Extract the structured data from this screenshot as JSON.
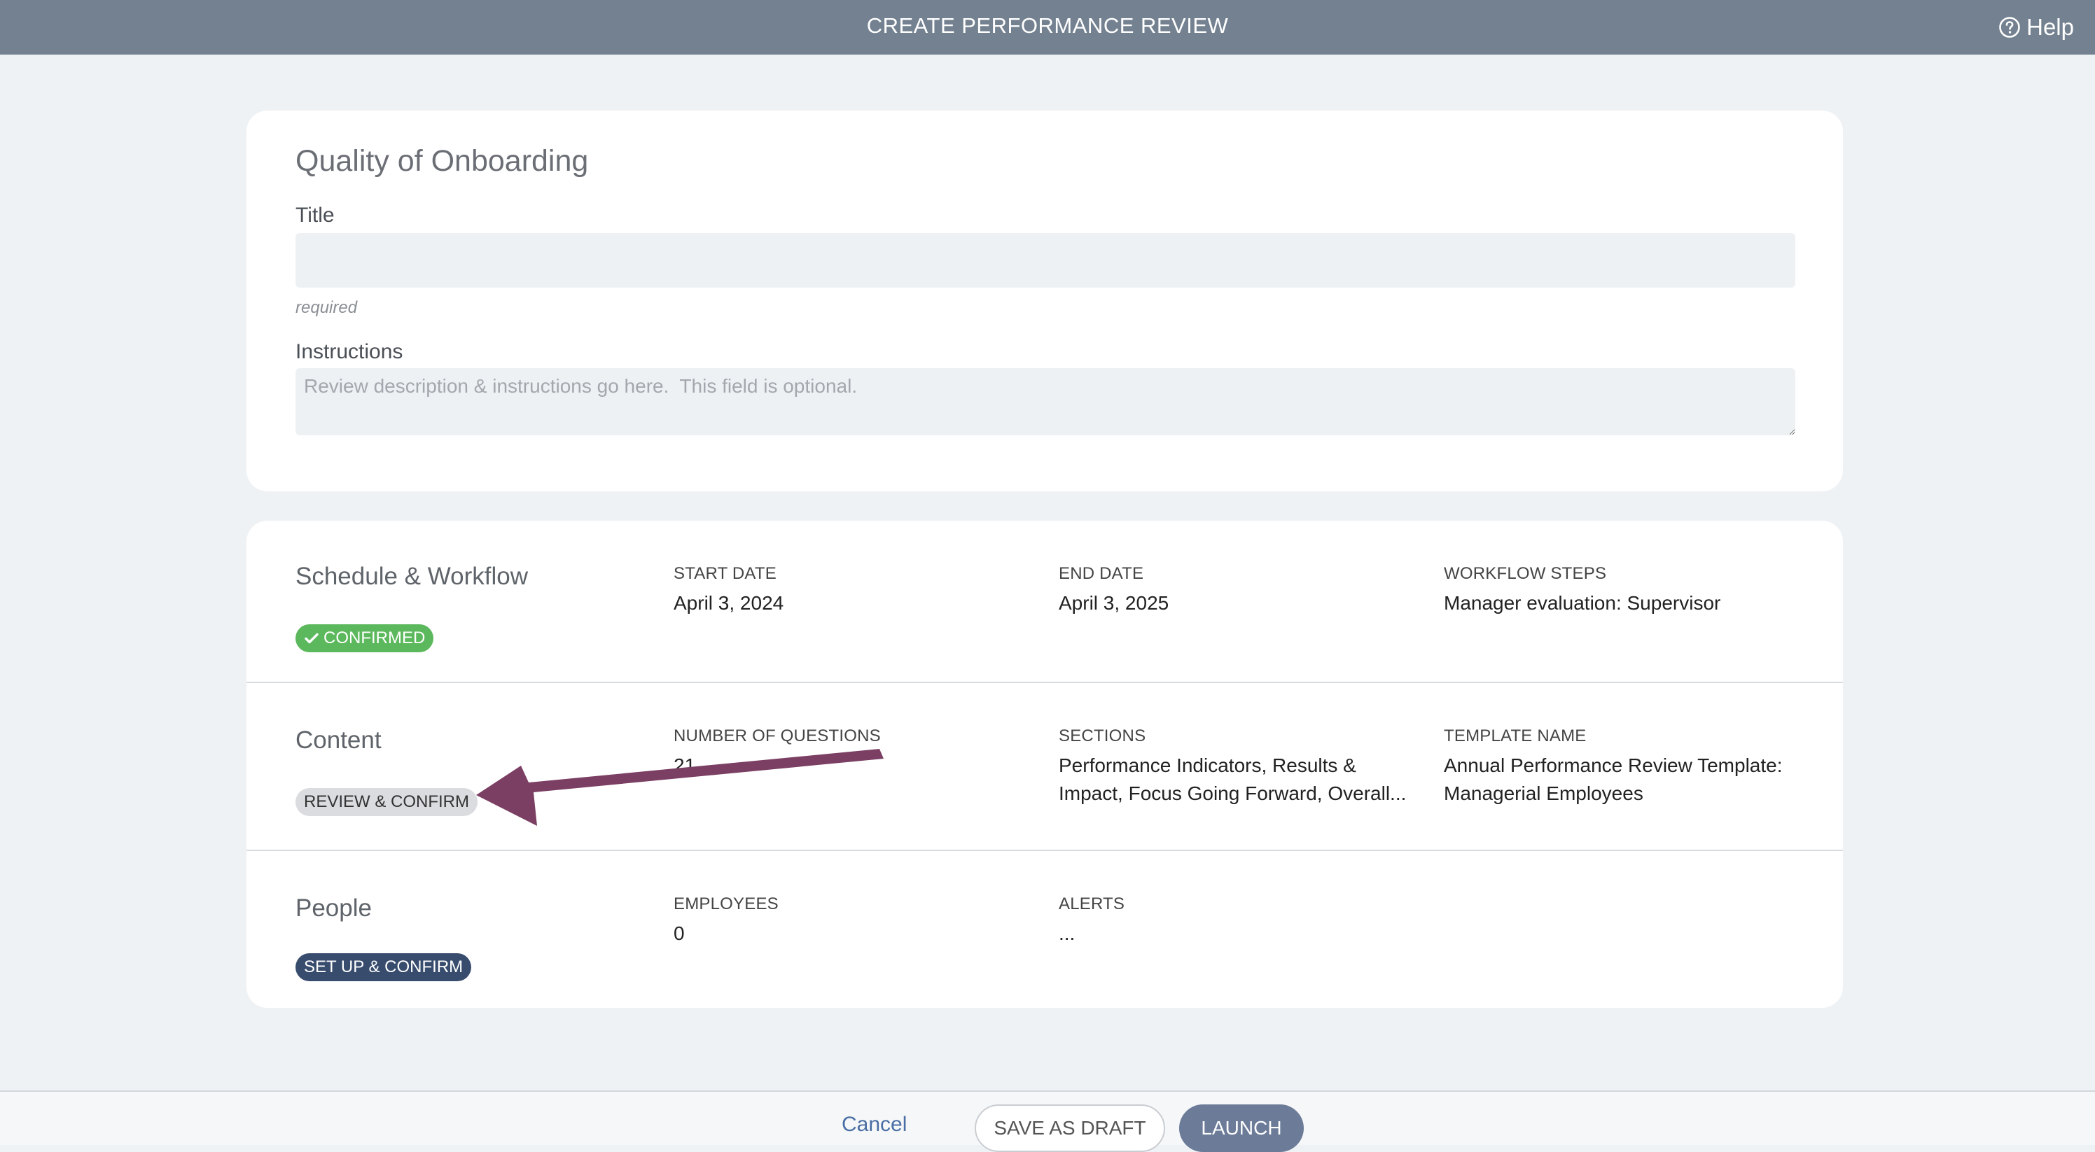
{
  "header": {
    "title": "CREATE PERFORMANCE REVIEW",
    "help_label": "Help"
  },
  "review": {
    "name": "Quality of Onboarding",
    "title_label": "Title",
    "title_value": "",
    "title_hint": "required",
    "instructions_label": "Instructions",
    "instructions_placeholder": "Review description & instructions go here.  This field is optional."
  },
  "schedule": {
    "title": "Schedule & Workflow",
    "status": "CONFIRMED",
    "start_label": "START DATE",
    "start_value": "April 3, 2024",
    "end_label": "END DATE",
    "end_value": "April 3, 2025",
    "workflow_label": "WORKFLOW STEPS",
    "workflow_value": "Manager evaluation: Supervisor"
  },
  "content": {
    "title": "Content",
    "status": "REVIEW & CONFIRM",
    "questions_label": "NUMBER OF QUESTIONS",
    "questions_value": "21",
    "sections_label": "SECTIONS",
    "sections_value": "Performance Indicators, Results & Impact, Focus Going Forward, Overall...",
    "template_label": "TEMPLATE NAME",
    "template_value": "Annual Performance Review Template: Managerial Employees"
  },
  "people": {
    "title": "People",
    "status": "SET UP & CONFIRM",
    "employees_label": "EMPLOYEES",
    "employees_value": "0",
    "alerts_label": "ALERTS",
    "alerts_value": "..."
  },
  "footer": {
    "cancel_label": "Cancel",
    "draft_label": "SAVE AS DRAFT",
    "launch_label": "LAUNCH"
  },
  "colors": {
    "topbar": "#738190",
    "confirmed": "#5cb85c",
    "setup": "#384c6e",
    "launch": "#6b7b98",
    "annotation_arrow": "#7b3f63"
  },
  "icons": {
    "help": "question-circle-icon",
    "confirmed": "check-icon"
  }
}
